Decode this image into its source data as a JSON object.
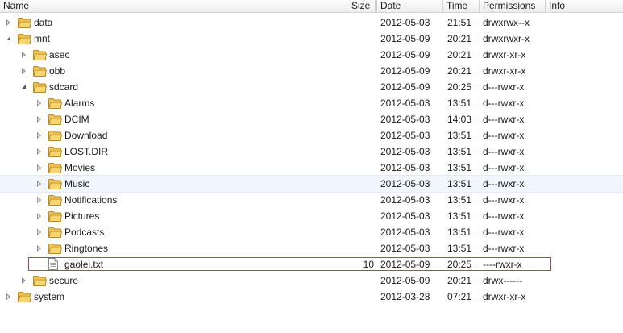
{
  "columns": {
    "name": "Name",
    "size": "Size",
    "date": "Date",
    "time": "Time",
    "permissions": "Permissions",
    "info": "Info"
  },
  "rows": [
    {
      "name": "data",
      "type": "folder",
      "depth": 0,
      "state": "collapsed",
      "size": "",
      "date": "2012-05-03",
      "time": "21:51",
      "permissions": "drwxrwx--x"
    },
    {
      "name": "mnt",
      "type": "folder",
      "depth": 0,
      "state": "expanded",
      "size": "",
      "date": "2012-05-09",
      "time": "20:21",
      "permissions": "drwxrwxr-x"
    },
    {
      "name": "asec",
      "type": "folder",
      "depth": 1,
      "state": "collapsed",
      "size": "",
      "date": "2012-05-09",
      "time": "20:21",
      "permissions": "drwxr-xr-x"
    },
    {
      "name": "obb",
      "type": "folder",
      "depth": 1,
      "state": "collapsed",
      "size": "",
      "date": "2012-05-09",
      "time": "20:21",
      "permissions": "drwxr-xr-x"
    },
    {
      "name": "sdcard",
      "type": "folder",
      "depth": 1,
      "state": "expanded",
      "size": "",
      "date": "2012-05-09",
      "time": "20:25",
      "permissions": "d---rwxr-x"
    },
    {
      "name": "Alarms",
      "type": "folder",
      "depth": 2,
      "state": "collapsed",
      "size": "",
      "date": "2012-05-03",
      "time": "13:51",
      "permissions": "d---rwxr-x"
    },
    {
      "name": "DCIM",
      "type": "folder",
      "depth": 2,
      "state": "collapsed",
      "size": "",
      "date": "2012-05-03",
      "time": "14:03",
      "permissions": "d---rwxr-x"
    },
    {
      "name": "Download",
      "type": "folder",
      "depth": 2,
      "state": "collapsed",
      "size": "",
      "date": "2012-05-03",
      "time": "13:51",
      "permissions": "d---rwxr-x"
    },
    {
      "name": "LOST.DIR",
      "type": "folder",
      "depth": 2,
      "state": "collapsed",
      "size": "",
      "date": "2012-05-03",
      "time": "13:51",
      "permissions": "d---rwxr-x"
    },
    {
      "name": "Movies",
      "type": "folder",
      "depth": 2,
      "state": "collapsed",
      "size": "",
      "date": "2012-05-03",
      "time": "13:51",
      "permissions": "d---rwxr-x"
    },
    {
      "name": "Music",
      "type": "folder",
      "depth": 2,
      "state": "collapsed",
      "size": "",
      "date": "2012-05-03",
      "time": "13:51",
      "permissions": "d---rwxr-x",
      "hovered": true
    },
    {
      "name": "Notifications",
      "type": "folder",
      "depth": 2,
      "state": "collapsed",
      "size": "",
      "date": "2012-05-03",
      "time": "13:51",
      "permissions": "d---rwxr-x"
    },
    {
      "name": "Pictures",
      "type": "folder",
      "depth": 2,
      "state": "collapsed",
      "size": "",
      "date": "2012-05-03",
      "time": "13:51",
      "permissions": "d---rwxr-x"
    },
    {
      "name": "Podcasts",
      "type": "folder",
      "depth": 2,
      "state": "collapsed",
      "size": "",
      "date": "2012-05-03",
      "time": "13:51",
      "permissions": "d---rwxr-x"
    },
    {
      "name": "Ringtones",
      "type": "folder",
      "depth": 2,
      "state": "collapsed",
      "size": "",
      "date": "2012-05-03",
      "time": "13:51",
      "permissions": "d---rwxr-x"
    },
    {
      "name": "gaolei.txt",
      "type": "file",
      "depth": 2,
      "state": "none",
      "size": "10",
      "date": "2012-05-09",
      "time": "20:25",
      "permissions": "----rwxr-x",
      "highlighted": true
    },
    {
      "name": "secure",
      "type": "folder",
      "depth": 1,
      "state": "collapsed",
      "size": "",
      "date": "2012-05-09",
      "time": "20:21",
      "permissions": "drwx------"
    },
    {
      "name": "system",
      "type": "folder",
      "depth": 0,
      "state": "collapsed",
      "size": "",
      "date": "2012-03-28",
      "time": "07:21",
      "permissions": "drwxr-xr-x"
    }
  ],
  "colors": {
    "folder_fill": "#f2c44f",
    "folder_edge": "#b98a22",
    "highlight_border": "#d33a3a",
    "hover_bg": "#f0f6fc"
  }
}
